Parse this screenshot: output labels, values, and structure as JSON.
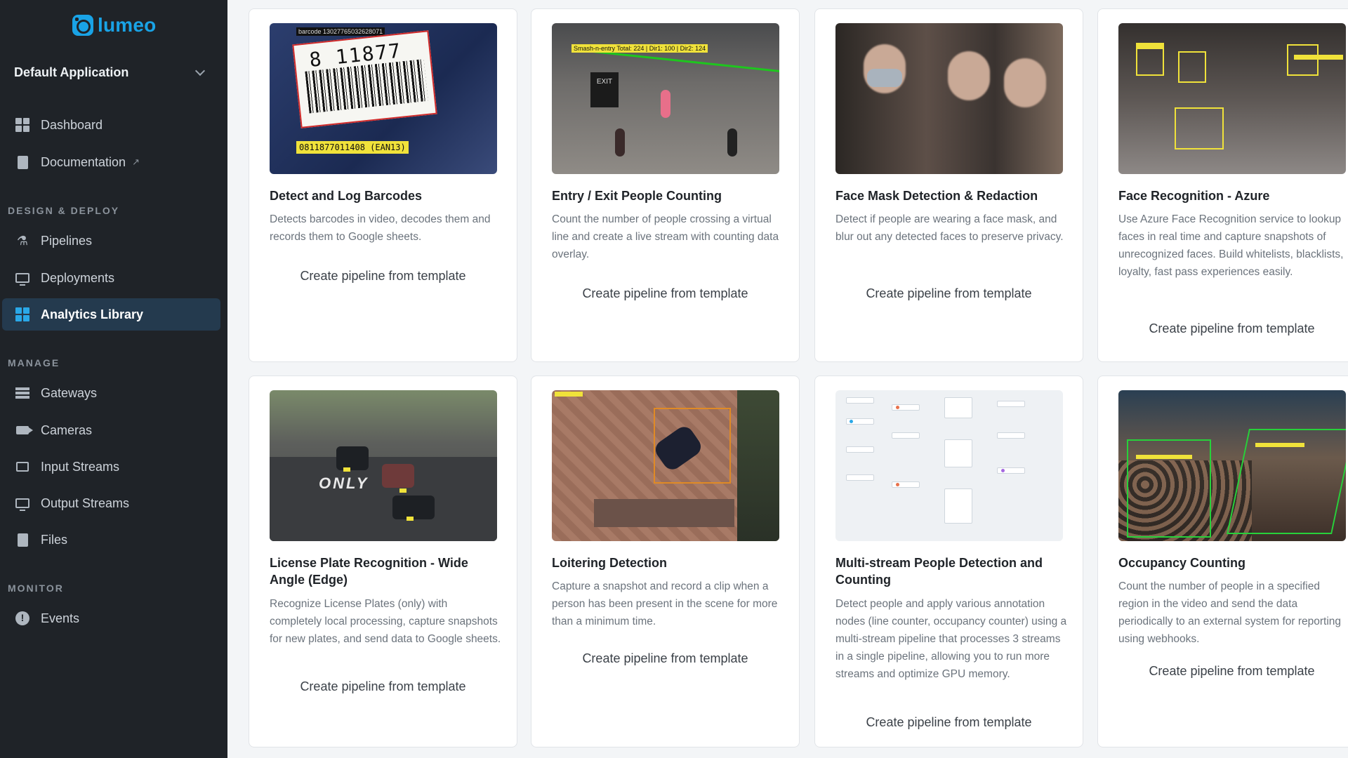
{
  "brand": {
    "name": "lumeo",
    "accent": "#19a3e6"
  },
  "app_selector": {
    "label": "Default Application"
  },
  "sidebar": {
    "top_items": [
      {
        "label": "Dashboard",
        "icon": "dashboard-icon"
      },
      {
        "label": "Documentation",
        "icon": "book-icon",
        "external": true
      }
    ],
    "sections": [
      {
        "heading": "DESIGN & DEPLOY",
        "items": [
          {
            "label": "Pipelines",
            "icon": "pipelines-icon"
          },
          {
            "label": "Deployments",
            "icon": "deployments-icon"
          },
          {
            "label": "Analytics Library",
            "icon": "analytics-icon",
            "active": true
          }
        ]
      },
      {
        "heading": "MANAGE",
        "items": [
          {
            "label": "Gateways",
            "icon": "gateway-icon"
          },
          {
            "label": "Cameras",
            "icon": "camera-icon"
          },
          {
            "label": "Input Streams",
            "icon": "cast-icon"
          },
          {
            "label": "Output Streams",
            "icon": "monitor-icon"
          },
          {
            "label": "Files",
            "icon": "file-icon"
          }
        ]
      },
      {
        "heading": "MONITOR",
        "items": [
          {
            "label": "Events",
            "icon": "alert-icon"
          }
        ]
      }
    ]
  },
  "cards": [
    {
      "title": "Detect and Log Barcodes",
      "description": "Detects barcodes in video, decodes them and records them to Google sheets.",
      "cta": "Create pipeline from template",
      "thumb": {
        "caption": "barcode 13027765032628071",
        "digits": "8 11877 01140",
        "tag": "0811877011408 (EAN13)"
      }
    },
    {
      "title": "Entry / Exit People Counting",
      "description": "Count the number of people crossing a virtual line and create a live stream with counting data overlay.",
      "cta": "Create pipeline from template",
      "thumb": {
        "tag": "Smash-n-entry Total: 224 | Dir1: 100 | Dir2: 124",
        "sign": "EXIT"
      }
    },
    {
      "title": "Face Mask Detection & Redaction",
      "description": "Detect if people are wearing a face mask, and blur out any detected faces to preserve privacy.",
      "cta": "Create pipeline from template"
    },
    {
      "title": "Face Recognition - Azure",
      "description": "Use Azure Face Recognition service to lookup faces in real time and capture snapshots of unrecognized faces. Build whitelists, blacklists, loyalty, fast pass experiences easily.",
      "cta": "Create pipeline from template"
    },
    {
      "title": "License Plate Recognition - Wide Angle (Edge)",
      "description": "Recognize License Plates (only) with completely local processing, capture snapshots for new plates, and send data to Google sheets.",
      "cta": "Create pipeline from template",
      "thumb": {
        "road_text": "ONLY"
      }
    },
    {
      "title": "Loitering Detection",
      "description": "Capture a snapshot and record a clip when a person has been present in the scene for more than a minimum time.",
      "cta": "Create pipeline from template"
    },
    {
      "title": "Multi-stream People Detection and Counting",
      "description": "Detect people and apply various annotation nodes (line counter, occupancy counter) using a multi-stream pipeline that processes 3 streams in a single pipeline, allowing you to run more streams and optimize GPU memory.",
      "cta": "Create pipeline from template"
    },
    {
      "title": "Occupancy Counting",
      "description": "Count the number of people in a specified region in the video and send the data periodically to an external system for reporting using webhooks.",
      "cta": "Create pipeline from template"
    }
  ]
}
